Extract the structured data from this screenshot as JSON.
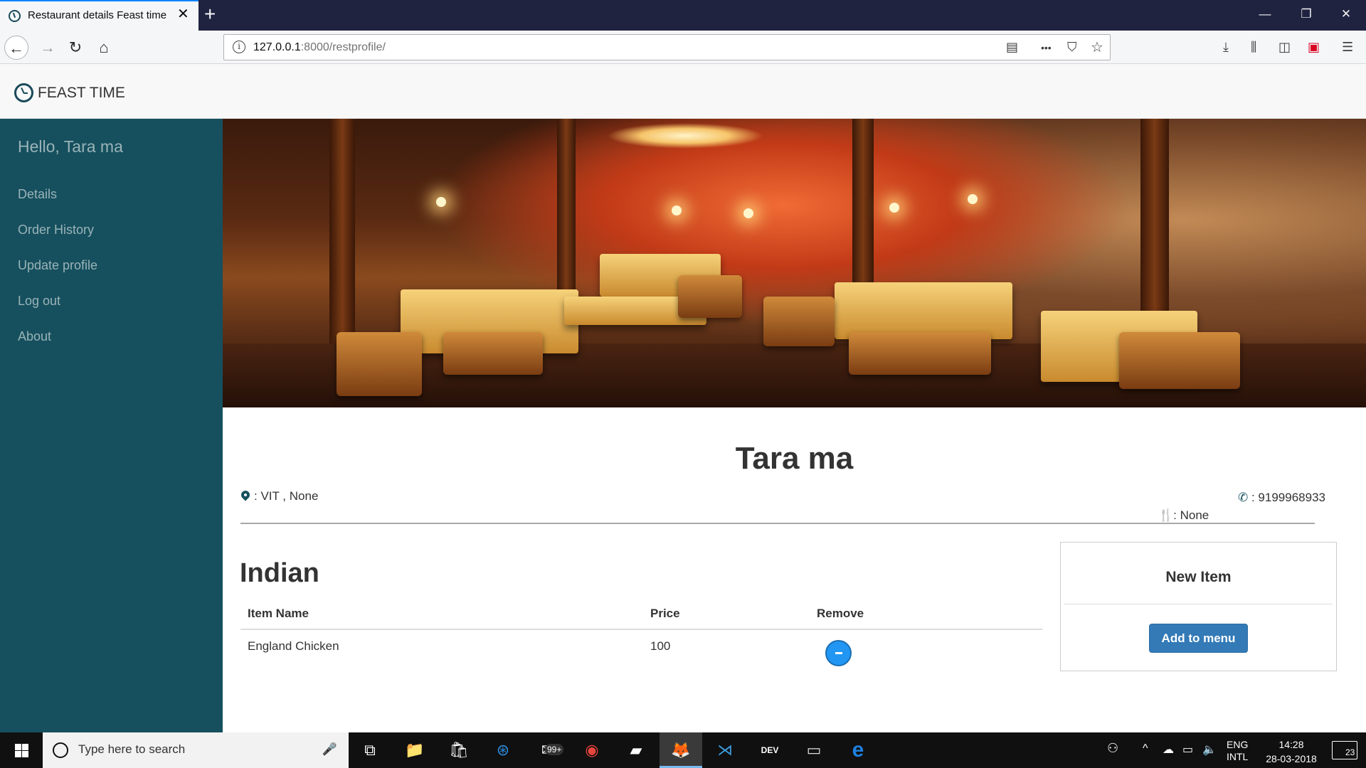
{
  "browser": {
    "tab_title": "Restaurant details Feast time",
    "tab_close": "✕",
    "new_tab": "+",
    "window_controls": {
      "minimize": "—",
      "restore": "❐",
      "close": "✕"
    },
    "nav": {
      "back": "←",
      "forward": "→",
      "reload": "↻",
      "home": "⌂"
    },
    "url_host": "127.0.0.1",
    "url_path": ":8000/restprofile/",
    "url_info": "i",
    "url_actions": {
      "reader": "▤",
      "more": "•••",
      "pocket": "⛉",
      "bookmark": "☆"
    },
    "toolbar": {
      "download": "⤓",
      "library": "⫼",
      "sidebar": "◫",
      "screenshot": "▣",
      "menu": "☰"
    }
  },
  "site": {
    "brand": "FEAST TIME"
  },
  "sidebar": {
    "greeting": "Hello, Tara ma",
    "items": [
      {
        "label": "Details"
      },
      {
        "label": "Order History"
      },
      {
        "label": "Update profile"
      },
      {
        "label": "Log out"
      },
      {
        "label": "About"
      }
    ]
  },
  "restaurant": {
    "name": "Tara ma",
    "address": ": VIT , None",
    "phone": ": 9199968933",
    "cuisine_tag": ": None",
    "icons": {
      "location": "location-pin",
      "phone": "✆",
      "cutlery": "🍴"
    }
  },
  "menu": {
    "category": "Indian",
    "columns": [
      "Item Name",
      "Price",
      "Remove"
    ],
    "rows": [
      {
        "name": "England Chicken",
        "price": "100"
      }
    ]
  },
  "new_item": {
    "title": "New Item",
    "button": "Add to menu"
  },
  "taskbar": {
    "search_placeholder": "Type here to search",
    "mic": "🎤",
    "apps": [
      {
        "name": "task-view",
        "glyph": "⧉"
      },
      {
        "name": "file-explorer",
        "glyph": "📁"
      },
      {
        "name": "store",
        "glyph": "🛍"
      },
      {
        "name": "safari-compass",
        "glyph": "⊛"
      },
      {
        "name": "mail",
        "glyph": "✉",
        "badge": "99+"
      },
      {
        "name": "chrome",
        "glyph": "◉"
      },
      {
        "name": "sticky-notes",
        "glyph": "▰"
      },
      {
        "name": "firefox",
        "glyph": "🦊"
      },
      {
        "name": "vscode",
        "glyph": "⋊"
      },
      {
        "name": "dev-tools",
        "glyph": "DEV"
      },
      {
        "name": "terminal",
        "glyph": "▭"
      },
      {
        "name": "edge",
        "glyph": "e"
      }
    ],
    "tray": {
      "people": "⚇",
      "chevron": "^",
      "lang_top": "ENG",
      "lang_bottom": "INTL",
      "time": "14:28",
      "date": "28-03-2018",
      "notifications": "23"
    }
  },
  "colors": {
    "sidebar_bg": "#16505e",
    "sidebar_text": "#9ab3b8",
    "primary_button": "#337ab7",
    "remove_button": "#2196f3",
    "tab_bar": "#202340"
  }
}
